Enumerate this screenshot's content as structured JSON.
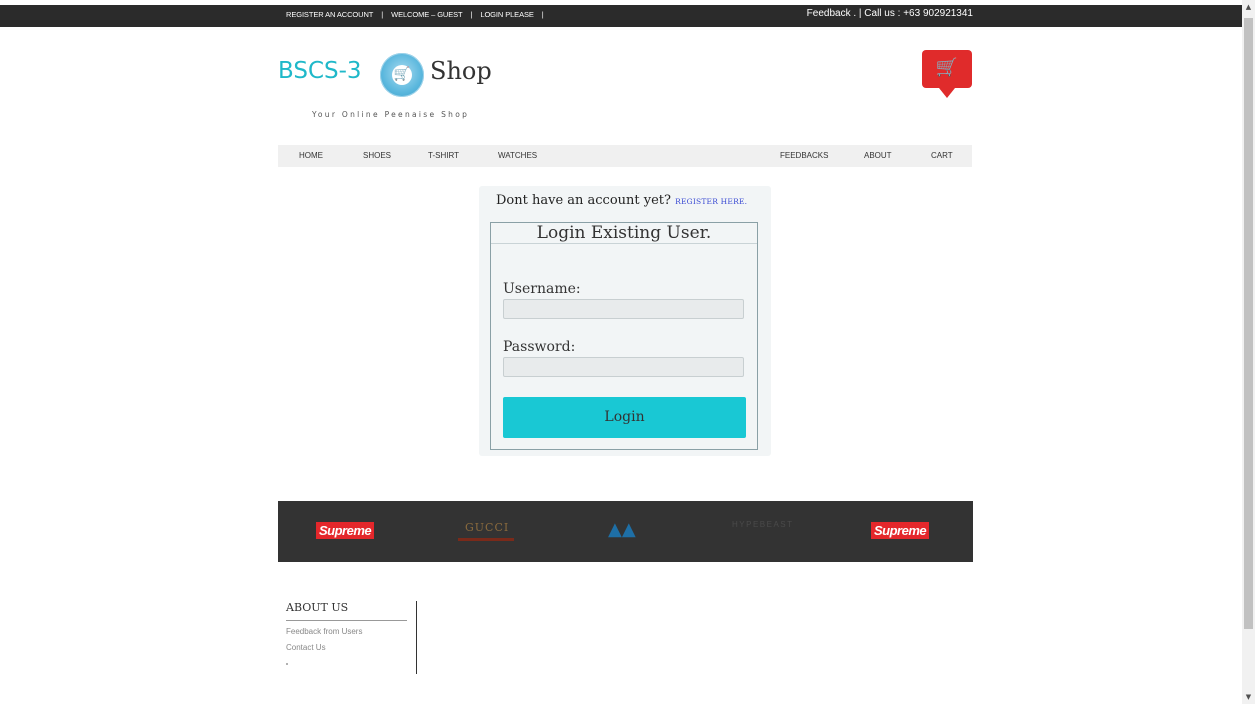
{
  "topbar": {
    "register": "REGISTER AN ACCOUNT",
    "welcome": "WELCOME – GUEST",
    "login": "LOGIN PLEASE",
    "separator": "|",
    "feedback": "Feedback . | Call us : +63 902921341"
  },
  "logo": {
    "part1": "BSCS-3",
    "part2": "Shop",
    "tagline": "Your Online Peenaise Shop"
  },
  "nav": {
    "home": "HOME",
    "shoes": "SHOES",
    "tshirt": "T-SHIRT",
    "watches": "WATCHES",
    "feedbacks": "FEEDBACKS",
    "about": "ABOUT",
    "cart": "CART"
  },
  "login": {
    "prompt": "Dont have an account yet? ",
    "register_link": "REGISTER HERE.",
    "title": "Login Existing User.",
    "username_label": "Username:",
    "password_label": "Password:",
    "button": "Login"
  },
  "brands": {
    "supreme1": "Supreme",
    "gucci": "GUCCI",
    "hypebeast": "HYPEBEAST",
    "supreme2": "Supreme"
  },
  "footer": {
    "heading": "ABOUT US",
    "link1": "Feedback from Users",
    "link2": "Contact Us"
  },
  "colors": {
    "accent": "#19c8d4",
    "cart_red": "#e02b2b",
    "topbar": "#2b2b2b",
    "brand_strip": "#333333"
  }
}
